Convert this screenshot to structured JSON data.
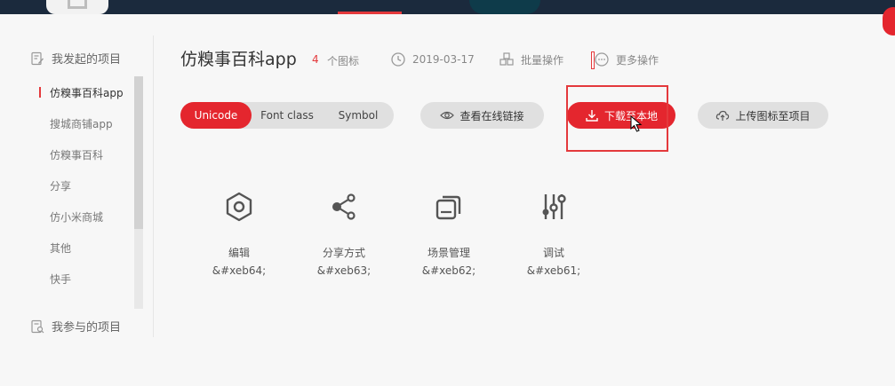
{
  "sidebar": {
    "my_projects_label": "我发起的项目",
    "joined_projects_label": "我参与的项目",
    "items": [
      {
        "label": "仿糗事百科app",
        "active": true
      },
      {
        "label": "搜城商铺app",
        "active": false
      },
      {
        "label": "仿糗事百科",
        "active": false
      },
      {
        "label": "分享",
        "active": false
      },
      {
        "label": "仿小米商城",
        "active": false
      },
      {
        "label": "其他",
        "active": false
      },
      {
        "label": "快手",
        "active": false
      }
    ]
  },
  "header": {
    "title": "仿糗事百科app",
    "icon_count": "4",
    "icon_count_label": "个图标",
    "date": "2019-03-17",
    "batch_ops_label": "批量操作",
    "more_ops_label": "更多操作"
  },
  "toolbar": {
    "tabs": [
      "Unicode",
      "Font class",
      "Symbol"
    ],
    "active_tab": "Unicode",
    "view_online_link_label": "查看在线链接",
    "download_label": "下载至本地",
    "upload_label": "上传图标至项目"
  },
  "glyphs": [
    {
      "name": "编辑",
      "code": "&#xeb64;",
      "icon": "hexagon-nut-icon"
    },
    {
      "name": "分享方式",
      "code": "&#xeb63;",
      "icon": "share-icon"
    },
    {
      "name": "场景管理",
      "code": "&#xeb62;",
      "icon": "layers-icon"
    },
    {
      "name": "调试",
      "code": "&#xeb61;",
      "icon": "sliders-icon"
    }
  ],
  "colors": {
    "accent": "#e4262e",
    "top_bar": "#1b2a3d",
    "background": "#f7f7f7"
  }
}
